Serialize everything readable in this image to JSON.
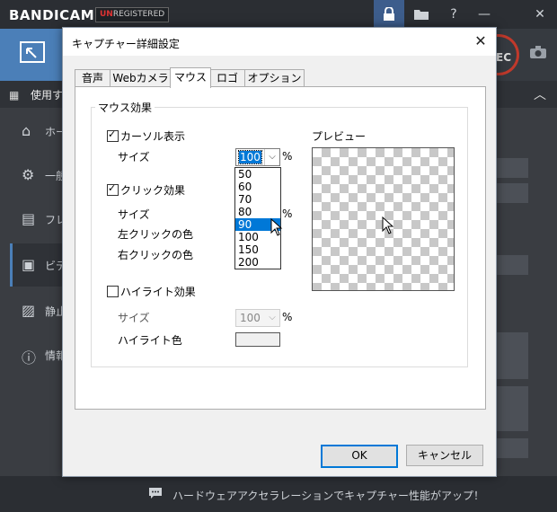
{
  "app": {
    "logo": "BANDICAM",
    "unregistered_prefix": "UN",
    "unregistered_rest": "REGISTERED",
    "menu_label": "使用す",
    "rec_label": "EC",
    "bottom_message": "ハードウェアアクセラレーションでキャプチャー性能がアップ！",
    "sidebar": [
      {
        "label": "ホー",
        "icon": "home-icon"
      },
      {
        "label": "一般",
        "icon": "gear-icon"
      },
      {
        "label": "フレ",
        "icon": "frame-icon"
      },
      {
        "label": "ビデ",
        "icon": "video-icon"
      },
      {
        "label": "静止",
        "icon": "image-icon"
      },
      {
        "label": "情報",
        "icon": "info-icon"
      }
    ]
  },
  "dialog": {
    "title": "キャプチャー詳細設定",
    "tabs": [
      "音声",
      "Webカメラ",
      "マウス",
      "ロゴ",
      "オプション"
    ],
    "active_tab": "マウス",
    "group_title": "マウス効果",
    "cursor_show": {
      "label": "カーソル表示",
      "checked": true
    },
    "size_label": "サイズ",
    "size_value": "100",
    "percent": "%",
    "size_options": [
      "50",
      "60",
      "70",
      "80",
      "90",
      "100",
      "150",
      "200"
    ],
    "hovered_option": "90",
    "click_effect": {
      "label": "クリック効果",
      "checked": true
    },
    "click_size_label": "サイズ",
    "left_click_color": "左クリックの色",
    "right_click_color": "右クリックの色",
    "highlight": {
      "label": "ハイライト効果",
      "checked": false
    },
    "highlight_size_label": "サイズ",
    "highlight_size_value": "100",
    "highlight_color_label": "ハイライト色",
    "preview_label": "プレビュー",
    "ok_label": "OK",
    "cancel_label": "キャンセル"
  }
}
